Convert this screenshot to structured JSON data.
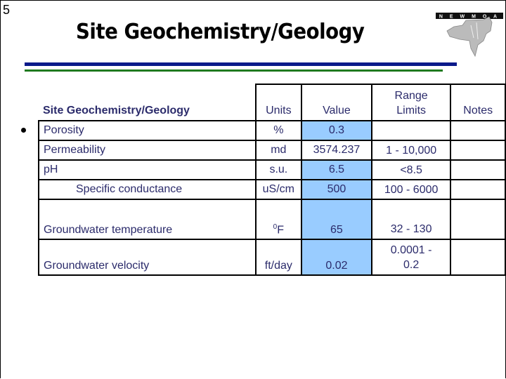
{
  "slide_number": "5",
  "title": "Site Geochemistry/Geology",
  "logo_text": "NEWMOA",
  "colors": {
    "rule_blue": "#0a1a8a",
    "rule_green": "#1f7a1f",
    "highlight": "#99ccff",
    "text": "#2b2b6b"
  },
  "table": {
    "headers": {
      "parameter": "Site Geochemistry/Geology",
      "units": "Units",
      "value": "Value",
      "range_line1": "Range",
      "range_line2": "Limits",
      "notes": "Notes"
    },
    "rows": [
      {
        "parameter": "Porosity",
        "units": "%",
        "value": "0.3",
        "range": "",
        "notes": "",
        "highlight": true
      },
      {
        "parameter": "Permeability",
        "units": "md",
        "value": "3574.237",
        "range": "1  -  10,000",
        "notes": "",
        "highlight": false
      },
      {
        "parameter": "pH",
        "units": "s.u.",
        "value": "6.5",
        "range": "<8.5",
        "notes": "",
        "highlight": true
      },
      {
        "parameter": "Specific conductance",
        "units": "uS/cm",
        "value": "500",
        "range": "100  -  6000",
        "notes": "",
        "highlight": true
      },
      {
        "parameter": "Groundwater temperature",
        "units_sup": "0",
        "units": "F",
        "value": "65",
        "range": "32  -  130",
        "notes": "",
        "highlight": true
      },
      {
        "parameter": "Groundwater velocity",
        "units": "ft/day",
        "value": "0.02",
        "range_line1": "0.0001  -",
        "range_line2": "0.2",
        "notes": "",
        "highlight": true
      }
    ]
  }
}
